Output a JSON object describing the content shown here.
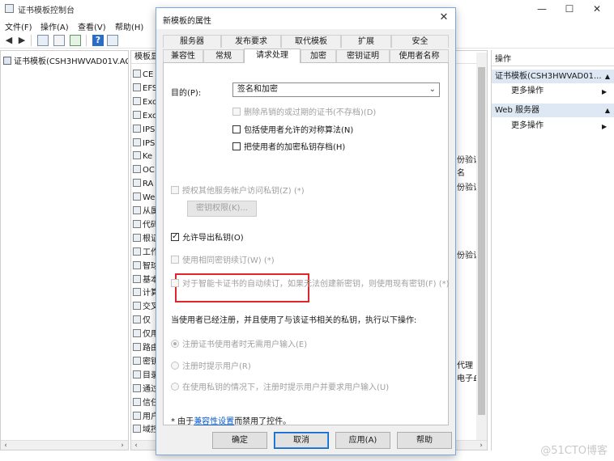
{
  "mmc": {
    "title": "证书模板控制台",
    "window_controls": [
      "—",
      "☐",
      "✕"
    ],
    "menu": [
      "文件(F)",
      "操作(A)",
      "查看(V)",
      "帮助(H)"
    ],
    "tree_root": "证书模板(CSH3HWVAD01V.AC",
    "list_header": "模板显",
    "list_items": [
      "CE",
      "EFS",
      "Exc",
      "Exc",
      "IPS",
      "IPS",
      "Ke",
      "OC",
      "RA",
      "We",
      "从属",
      "代码",
      "根证",
      "工作",
      "智球",
      "基本",
      "计算",
      "交叉",
      "仅",
      "仅用",
      "路由",
      "密钥",
      "目录",
      "通过",
      "信任",
      "用户",
      "域控"
    ],
    "right_fragments": [
      "份验证",
      "名",
      "份验证",
      "份验证",
      "代理",
      "电子£"
    ],
    "actions": {
      "header": "操作",
      "section1": "证书模板(CSH3HWVAD01...",
      "more1": "更多操作",
      "section2": "Web 服务器",
      "more2": "更多操作"
    },
    "watermark": "@51CTO博客"
  },
  "dialog": {
    "title": "新模板的属性",
    "close": "✕",
    "tabs_row1": [
      "服务器",
      "发布要求",
      "取代模板",
      "扩展",
      "安全"
    ],
    "tabs_row2": [
      "兼容性",
      "常规",
      "请求处理",
      "加密",
      "密钥证明",
      "使用者名称"
    ],
    "active_tab": "请求处理",
    "purpose_label": "目的(P):",
    "purpose_value": "签名和加密",
    "opt_delete_revoked": "删除吊销的或过期的证书(不存档)(D)",
    "opt_symmetric": "包括使用者允许的对称算法(N)",
    "opt_archive": "把使用者的加密私钥存档(H)",
    "opt_authorize": "授权其他服务帐户访问私钥(Z) (*)",
    "key_permissions_button": "密钥权限(K)...",
    "opt_allow_export": "允许导出私钥(O)",
    "opt_renew_same_key": "使用相同密钥续订(W) (*)",
    "opt_smartcard": "对于智能卡证书的自动续订，如果无法创建新密钥，则使用现有密钥(F) (*)",
    "enroll_prompt": "当使用者已经注册，并且使用了与该证书相关的私钥，执行以下操作:",
    "radio1": "注册证书使用者时无需用户输入(E)",
    "radio2": "注册时提示用户(R)",
    "radio3": "在使用私钥的情况下，注册时提示用户并要求用户输入(U)",
    "note_prefix": "* 由于",
    "note_link": "兼容性设置",
    "note_suffix": "而禁用了控件。",
    "btn_ok": "确定",
    "btn_cancel": "取消",
    "btn_apply": "应用(A)",
    "btn_help": "帮助"
  },
  "colors": {
    "highlight": "#e0262b",
    "link": "#0b58c4",
    "accent_border": "#0a64c6"
  }
}
